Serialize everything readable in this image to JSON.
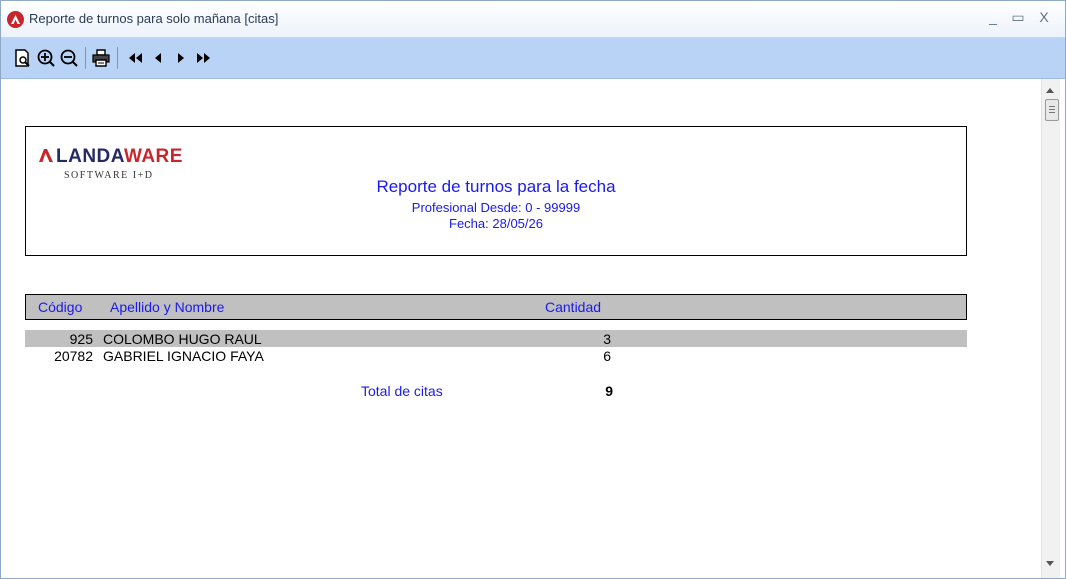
{
  "window": {
    "title": "Reporte de turnos para solo mañana [citas]",
    "minimize_glyph": "_",
    "maximize_glyph": "▭",
    "close_glyph": "X"
  },
  "toolbar": {
    "buttons": [
      {
        "name": "page-preview-icon"
      },
      {
        "name": "zoom-in-icon"
      },
      {
        "name": "zoom-out-icon"
      },
      {
        "name": "print-icon"
      },
      {
        "name": "first-page-icon"
      },
      {
        "name": "previous-page-icon"
      },
      {
        "name": "next-page-icon"
      },
      {
        "name": "last-page-icon"
      }
    ]
  },
  "report": {
    "logo_prefix": "L",
    "logo_name_a": "ANDA",
    "logo_name_b": "WARE",
    "logo_sub": "SOFTWARE I+D",
    "title": "Reporte de turnos para la fecha",
    "profesional": "Profesional Desde: 0 - 99999",
    "fecha": "Fecha: 28/05/26",
    "columns": {
      "codigo": "Código",
      "nombre": "Apellido y Nombre",
      "cantidad": "Cantidad"
    },
    "rows": [
      {
        "codigo": "925",
        "nombre": "COLOMBO HUGO RAUL",
        "cantidad": "3"
      },
      {
        "codigo": "20782",
        "nombre": "GABRIEL IGNACIO FAYA",
        "cantidad": "6"
      }
    ],
    "total_label": "Total de citas",
    "total_value": "9"
  },
  "colors": {
    "report_blue": "#1a1aee",
    "toolbar_bg": "#b8d3f5",
    "brand_red": "#c8262e",
    "brand_navy": "#262a62"
  }
}
